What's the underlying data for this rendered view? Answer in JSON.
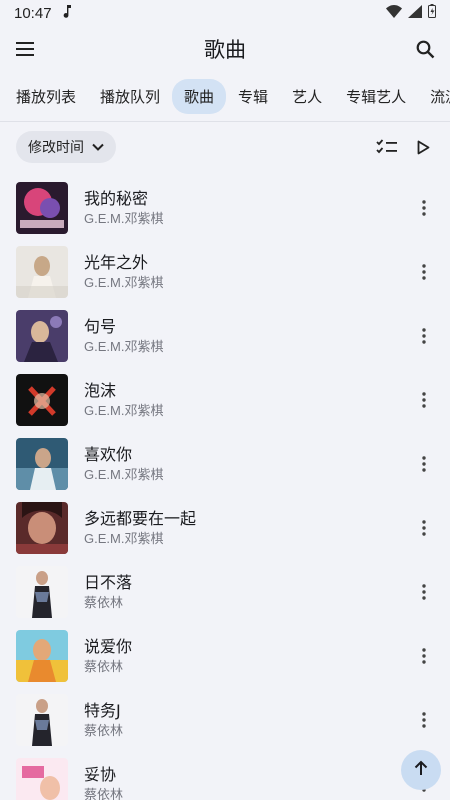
{
  "status_bar": {
    "time": "10:47",
    "note_icon": "music-note-icon",
    "wifi_icon": "wifi-icon",
    "signal_icon": "cell-signal-icon",
    "battery_icon": "battery-icon"
  },
  "app_bar": {
    "title": "歌曲",
    "menu_icon": "hamburger-menu-icon",
    "search_icon": "search-icon"
  },
  "tabs": [
    {
      "label": "播放列表"
    },
    {
      "label": "播放队列"
    },
    {
      "label": "歌曲",
      "active": true
    },
    {
      "label": "专辑"
    },
    {
      "label": "艺人"
    },
    {
      "label": "专辑艺人"
    },
    {
      "label": "流派"
    }
  ],
  "toolbar": {
    "sort_label": "修改时间",
    "sort_icon": "chevron-down-icon",
    "select_icon": "checklist-icon",
    "play_icon": "play-icon"
  },
  "songs": [
    {
      "title": "我的秘密",
      "artist": "G.E.M.邓紫棋",
      "cover_color": "#d8457a"
    },
    {
      "title": "光年之外",
      "artist": "G.E.M.邓紫棋",
      "cover_color": "#c9c4bc"
    },
    {
      "title": "句号",
      "artist": "G.E.M.邓紫棋",
      "cover_color": "#5a4a7a"
    },
    {
      "title": "泡沫",
      "artist": "G.E.M.邓紫棋",
      "cover_color": "#1a1a1a"
    },
    {
      "title": "喜欢你",
      "artist": "G.E.M.邓紫棋",
      "cover_color": "#3f6f8c"
    },
    {
      "title": "多远都要在一起",
      "artist": "G.E.M.邓紫棋",
      "cover_color": "#b0605a"
    },
    {
      "title": "日不落",
      "artist": "蔡依林",
      "cover_color": "#2a2a32"
    },
    {
      "title": "说爱你",
      "artist": "蔡依林",
      "cover_color": "#e7b33a"
    },
    {
      "title": "特务J",
      "artist": "蔡依林",
      "cover_color": "#2a2a32"
    },
    {
      "title": "妥协",
      "artist": "蔡依林",
      "cover_color": "#e56aa0"
    }
  ],
  "fab": {
    "icon": "arrow-up-icon"
  },
  "colors": {
    "background": "#f2f3f8",
    "active_tab": "#d3e2f4",
    "fab": "#c9dcf2"
  }
}
